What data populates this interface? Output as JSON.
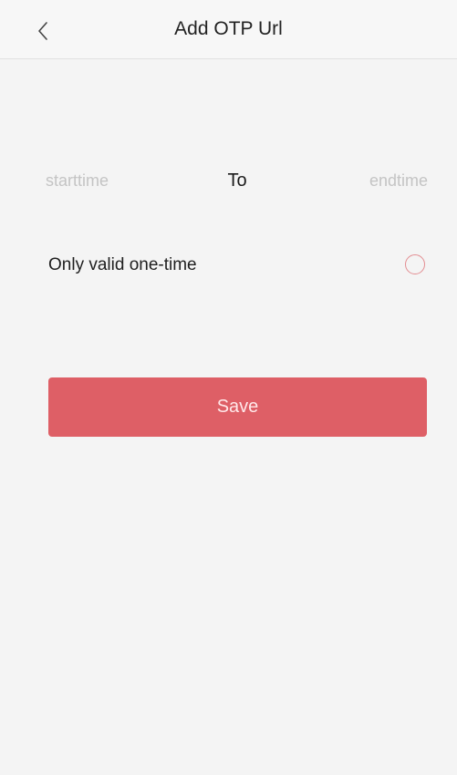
{
  "header": {
    "title": "Add OTP Url",
    "back_icon": "chevron-left-icon"
  },
  "time_range": {
    "start_placeholder": "starttime",
    "separator": "To",
    "end_placeholder": "endtime"
  },
  "onetime": {
    "label": "Only valid one-time",
    "checked": false
  },
  "save": {
    "label": "Save"
  },
  "colors": {
    "accent": "#de5f66",
    "radio_border": "#e38d91",
    "background": "#f4f4f4",
    "placeholder_text": "#c4c4c4"
  }
}
